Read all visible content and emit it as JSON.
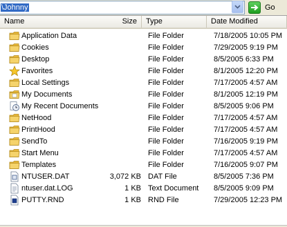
{
  "address": {
    "value": "\\Johnny",
    "go_label": "Go"
  },
  "columns": {
    "name": "Name",
    "size": "Size",
    "type": "Type",
    "date": "Date Modified"
  },
  "files": [
    {
      "name": "Application Data",
      "size": "",
      "type": "File Folder",
      "date": "7/18/2005 10:05 PM",
      "icon": "folder-icon"
    },
    {
      "name": "Cookies",
      "size": "",
      "type": "File Folder",
      "date": "7/29/2005 9:19 PM",
      "icon": "folder-icon"
    },
    {
      "name": "Desktop",
      "size": "",
      "type": "File Folder",
      "date": "8/5/2005 6:33 PM",
      "icon": "folder-icon"
    },
    {
      "name": "Favorites",
      "size": "",
      "type": "File Folder",
      "date": "8/1/2005 12:20 PM",
      "icon": "favorites-star-icon"
    },
    {
      "name": "Local Settings",
      "size": "",
      "type": "File Folder",
      "date": "7/17/2005 4:57 AM",
      "icon": "folder-icon"
    },
    {
      "name": "My Documents",
      "size": "",
      "type": "File Folder",
      "date": "8/1/2005 12:19 PM",
      "icon": "my-documents-folder-icon"
    },
    {
      "name": "My Recent Documents",
      "size": "",
      "type": "File Folder",
      "date": "8/5/2005 9:06 PM",
      "icon": "recent-documents-clock-icon"
    },
    {
      "name": "NetHood",
      "size": "",
      "type": "File Folder",
      "date": "7/17/2005 4:57 AM",
      "icon": "folder-icon"
    },
    {
      "name": "PrintHood",
      "size": "",
      "type": "File Folder",
      "date": "7/17/2005 4:57 AM",
      "icon": "folder-icon"
    },
    {
      "name": "SendTo",
      "size": "",
      "type": "File Folder",
      "date": "7/16/2005 9:19 PM",
      "icon": "folder-icon"
    },
    {
      "name": "Start Menu",
      "size": "",
      "type": "File Folder",
      "date": "7/17/2005 4:57 AM",
      "icon": "folder-icon"
    },
    {
      "name": "Templates",
      "size": "",
      "type": "File Folder",
      "date": "7/16/2005 9:07 PM",
      "icon": "folder-icon"
    },
    {
      "name": "NTUSER.DAT",
      "size": "3,072 KB",
      "type": "DAT File",
      "date": "8/5/2005 7:36 PM",
      "icon": "dat-file-icon"
    },
    {
      "name": "ntuser.dat.LOG",
      "size": "1 KB",
      "type": "Text Document",
      "date": "8/5/2005 9:09 PM",
      "icon": "text-document-icon"
    },
    {
      "name": "PUTTY.RND",
      "size": "1 KB",
      "type": "RND File",
      "date": "7/29/2005 12:23 PM",
      "icon": "rnd-file-icon"
    }
  ],
  "colors": {
    "selection": "#316ac5",
    "folder": "#f5d36b",
    "go_green": "#2fae2f"
  }
}
